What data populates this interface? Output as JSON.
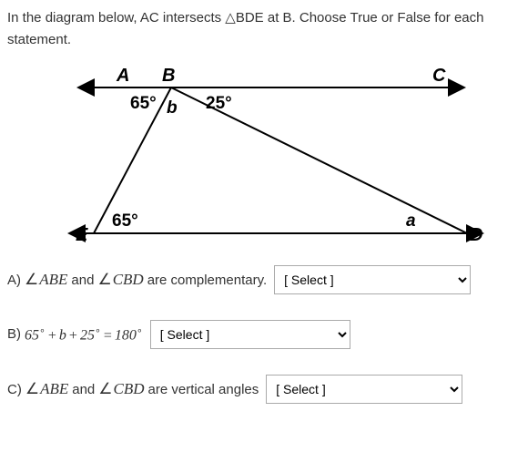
{
  "intro_text_1": "In the diagram below, AC intersects ",
  "intro_text_2": "BDE at B. Choose True or False for each statement.",
  "diagram": {
    "A": "A",
    "B": "B",
    "C": "C",
    "D": "D",
    "E": "E",
    "angle65_top": "65°",
    "angle25": "25°",
    "angle65_bottom": "65°",
    "var_b": "b",
    "var_a": "a"
  },
  "qA": {
    "prefix": "A) ",
    "angle1": "ABE",
    "mid": " and ",
    "angle2": "CBD",
    "suffix": " are complementary.",
    "select": "[ Select ]"
  },
  "qB": {
    "prefix": "B) ",
    "expr_65": "65",
    "expr_b": "b",
    "expr_25": "25",
    "expr_180": "180",
    "select": "[ Select ]"
  },
  "qC": {
    "prefix": "C) ",
    "angle1": "ABE",
    "mid": " and ",
    "angle2": "CBD",
    "suffix": " are vertical angles",
    "select": "[ Select ]"
  }
}
